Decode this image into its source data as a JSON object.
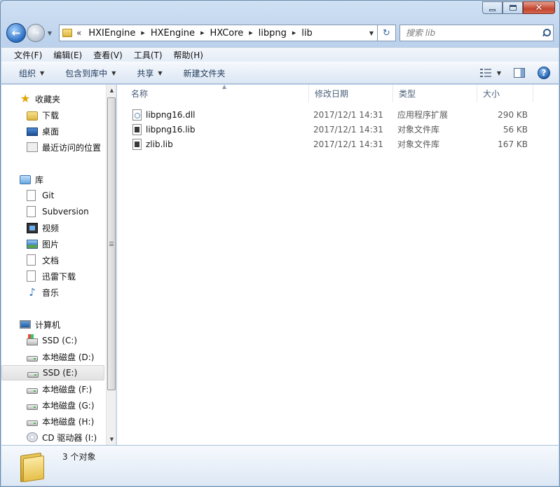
{
  "window": {
    "caption": {
      "minimize": "▁",
      "maximize": "□",
      "close": "✕"
    }
  },
  "nav": {
    "back_glyph": "←",
    "forward_glyph": "→",
    "history_dropdown": "▼",
    "address": {
      "overflow": "«",
      "crumbs": [
        "HXIEngine",
        "HXEngine",
        "HXCore",
        "libpng",
        "lib"
      ],
      "separator": "▶",
      "dropdown": "▼"
    },
    "refresh_glyph": "↻",
    "search": {
      "placeholder": "搜索 lib",
      "value": ""
    }
  },
  "menubar": {
    "items": [
      "文件(F)",
      "编辑(E)",
      "查看(V)",
      "工具(T)",
      "帮助(H)"
    ]
  },
  "toolbar": {
    "organize": "组织",
    "include_in_library": "包含到库中",
    "share": "共享",
    "new_folder": "新建文件夹",
    "dropdown": "▼",
    "help": "?"
  },
  "navpane": {
    "favorites": {
      "label": "收藏夹",
      "items": [
        "下载",
        "桌面",
        "最近访问的位置"
      ]
    },
    "libraries": {
      "label": "库",
      "items": [
        "Git",
        "Subversion",
        "视频",
        "图片",
        "文档",
        "迅雷下载",
        "音乐"
      ]
    },
    "computer": {
      "label": "计算机",
      "items": [
        "SSD (C:)",
        "本地磁盘 (D:)",
        "SSD (E:)",
        "本地磁盘 (F:)",
        "本地磁盘 (G:)",
        "本地磁盘 (H:)",
        "CD 驱动器 (I:)"
      ],
      "selected": "SSD (E:)"
    },
    "scroll_up": "▲",
    "scroll_down": "▼"
  },
  "columns": {
    "name": "名称",
    "date": "修改日期",
    "type": "类型",
    "size": "大小",
    "sort_indicator": "▲"
  },
  "files": [
    {
      "name": "libpng16.dll",
      "date": "2017/12/1 14:31",
      "type": "应用程序扩展",
      "size": "290 KB",
      "icon": "dll-file-icon"
    },
    {
      "name": "libpng16.lib",
      "date": "2017/12/1 14:31",
      "type": "对象文件库",
      "size": "56 KB",
      "icon": "lib-file-icon"
    },
    {
      "name": "zlib.lib",
      "date": "2017/12/1 14:31",
      "type": "对象文件库",
      "size": "167 KB",
      "icon": "lib-file-icon"
    }
  ],
  "details": {
    "count": "3 个对象"
  }
}
